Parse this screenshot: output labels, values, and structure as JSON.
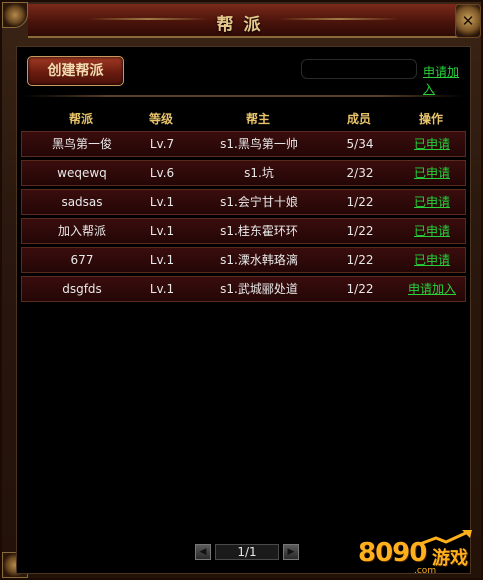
{
  "window": {
    "title": "帮派",
    "close_glyph": "✕"
  },
  "toolbar": {
    "create_label": "创建帮派",
    "search_value": "",
    "apply_label": "申请加入"
  },
  "table": {
    "headers": [
      "帮派",
      "等级",
      "帮主",
      "成员",
      "操作"
    ],
    "rows": [
      {
        "name": "黑鸟第一俊",
        "level": "Lv.7",
        "leader": "s1.黑鸟第一帅",
        "members": "5/34",
        "action": "已申请"
      },
      {
        "name": "weqewq",
        "level": "Lv.6",
        "leader": "s1.坑",
        "members": "2/32",
        "action": "已申请"
      },
      {
        "name": "sadsas",
        "level": "Lv.1",
        "leader": "s1.会宁甘十娘",
        "members": "1/22",
        "action": "已申请"
      },
      {
        "name": "加入帮派",
        "level": "Lv.1",
        "leader": "s1.桂东霍环环",
        "members": "1/22",
        "action": "已申请"
      },
      {
        "name": "677",
        "level": "Lv.1",
        "leader": "s1.溧水韩珞漓",
        "members": "1/22",
        "action": "已申请"
      },
      {
        "name": "dsgfds",
        "level": "Lv.1",
        "leader": "s1.武城郦处道",
        "members": "1/22",
        "action": "申请加入"
      }
    ]
  },
  "pagination": {
    "page_label": "1/1",
    "prev_glyph": "◀",
    "next_glyph": "▶"
  },
  "watermark": {
    "number": "8090",
    "word": "游戏",
    "domain": ".com"
  },
  "colors": {
    "accent_green": "#27d13a",
    "header_gold": "#e7c36a",
    "row_red": "#3a0d0d"
  },
  "icons": {
    "close": "close-icon",
    "prev": "chevron-left-icon",
    "next": "chevron-right-icon"
  }
}
